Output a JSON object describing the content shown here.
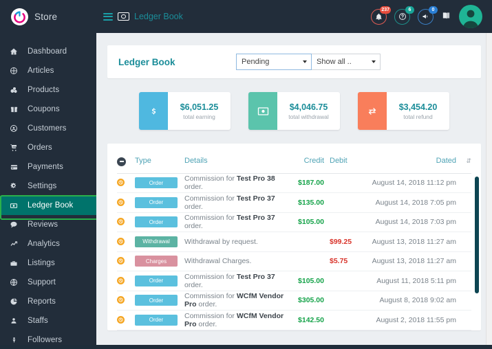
{
  "topbar": {
    "brand": "Store",
    "logo_icon": "power-logo-icon",
    "hamburger_icon": "hamburger-icon",
    "breadcrumb_icon": "money-note-icon",
    "breadcrumb": "Ledger Book",
    "notifications": {
      "icon": "bell-icon",
      "badge": "237",
      "color": "#e74c3c"
    },
    "help": {
      "icon": "question-circle-icon",
      "badge": "6",
      "color": "#18a497"
    },
    "announcements": {
      "icon": "megaphone-icon",
      "badge": "0",
      "color": "#2a7fd4"
    },
    "print": {
      "icon": "book-icon"
    },
    "avatar": {
      "icon": "user-avatar-icon",
      "color": "#1fb495"
    }
  },
  "sidebar": {
    "items": [
      {
        "label": "Dashboard",
        "icon": "home-icon",
        "active": false
      },
      {
        "label": "Articles",
        "icon": "articles-icon",
        "active": false
      },
      {
        "label": "Products",
        "icon": "products-icon",
        "active": false
      },
      {
        "label": "Coupons",
        "icon": "gift-icon",
        "active": false
      },
      {
        "label": "Customers",
        "icon": "user-circle-icon",
        "active": false
      },
      {
        "label": "Orders",
        "icon": "cart-icon",
        "active": false
      },
      {
        "label": "Payments",
        "icon": "credit-card-icon",
        "active": false
      },
      {
        "label": "Settings",
        "icon": "gears-icon",
        "active": false
      },
      {
        "label": "Ledger Book",
        "icon": "money-note-icon",
        "active": true
      },
      {
        "label": "Reviews",
        "icon": "comment-icon",
        "active": false
      },
      {
        "label": "Analytics",
        "icon": "chart-line-icon",
        "active": false
      },
      {
        "label": "Listings",
        "icon": "briefcase-icon",
        "active": false
      },
      {
        "label": "Support",
        "icon": "globe-icon",
        "active": false
      },
      {
        "label": "Reports",
        "icon": "pie-chart-icon",
        "active": false
      },
      {
        "label": "Staffs",
        "icon": "person-icon",
        "active": false
      },
      {
        "label": "Followers",
        "icon": "follower-icon",
        "active": false
      }
    ]
  },
  "panel": {
    "title": "Ledger Book",
    "status_filter": {
      "value": "Pending",
      "caret_icon": "caret-down-icon"
    },
    "show_filter": {
      "value": "Show all ..",
      "caret_icon": "caret-down-icon"
    }
  },
  "stats": [
    {
      "icon": "dollar-sign-icon",
      "glyph": "$",
      "value": "$6,051.25",
      "label": "total earning",
      "color": "#4fb8e0"
    },
    {
      "icon": "banknote-icon",
      "glyph": "\u0001",
      "value": "$4,046.75",
      "label": "total withdrawal",
      "color": "#5bc4ac"
    },
    {
      "icon": "refund-exchange-icon",
      "glyph": "⇄",
      "value": "$3,454.20",
      "label": "total refund",
      "color": "#f97e5b"
    }
  ],
  "table": {
    "select_all_icon": "minus-circle-icon",
    "sort_icon": "sort-updown-icon",
    "columns": {
      "type": "Type",
      "details": "Details",
      "credit": "Credit",
      "debit": "Debit",
      "dated": "Dated"
    },
    "rows": [
      {
        "status_icon": "clock-badge-icon",
        "type": "Order",
        "type_class": "order",
        "details_pre": "Commission for ",
        "details_bold": "Test Pro 38",
        "details_post": " order.",
        "credit": "$187.00",
        "debit": "",
        "dated": "August 14, 2018 11:12 pm"
      },
      {
        "status_icon": "clock-badge-icon",
        "type": "Order",
        "type_class": "order",
        "details_pre": "Commission for ",
        "details_bold": "Test Pro 37",
        "details_post": " order.",
        "credit": "$135.00",
        "debit": "",
        "dated": "August 14, 2018 7:05 pm"
      },
      {
        "status_icon": "clock-badge-icon",
        "type": "Order",
        "type_class": "order",
        "details_pre": "Commission for ",
        "details_bold": "Test Pro 37",
        "details_post": " order.",
        "credit": "$105.00",
        "debit": "",
        "dated": "August 14, 2018 7:03 pm"
      },
      {
        "status_icon": "clock-badge-icon",
        "type": "Withdrawal",
        "type_class": "withdrawal",
        "details_pre": "Withdrawal by request.",
        "details_bold": "",
        "details_post": "",
        "credit": "",
        "debit": "$99.25",
        "dated": "August 13, 2018 11:27 am"
      },
      {
        "status_icon": "clock-badge-icon",
        "type": "Charges",
        "type_class": "charges",
        "details_pre": "Withdrawal Charges.",
        "details_bold": "",
        "details_post": "",
        "credit": "",
        "debit": "$5.75",
        "dated": "August 13, 2018 11:27 am"
      },
      {
        "status_icon": "clock-badge-icon",
        "type": "Order",
        "type_class": "order",
        "details_pre": "Commission for ",
        "details_bold": "Test Pro 37",
        "details_post": " order.",
        "credit": "$105.00",
        "debit": "",
        "dated": "August 11, 2018 5:11 pm"
      },
      {
        "status_icon": "clock-badge-icon",
        "type": "Order",
        "type_class": "order",
        "details_pre": "Commission for ",
        "details_bold": "WCfM Vendor Pro",
        "details_post": " order.",
        "credit": "$305.00",
        "debit": "",
        "dated": "August 8, 2018 9:02 am"
      },
      {
        "status_icon": "clock-badge-icon",
        "type": "Order",
        "type_class": "order",
        "details_pre": "Commission for ",
        "details_bold": "WCfM Vendor Pro",
        "details_post": " order.",
        "credit": "$142.50",
        "debit": "",
        "dated": "August 2, 2018 11:55 pm"
      }
    ]
  }
}
